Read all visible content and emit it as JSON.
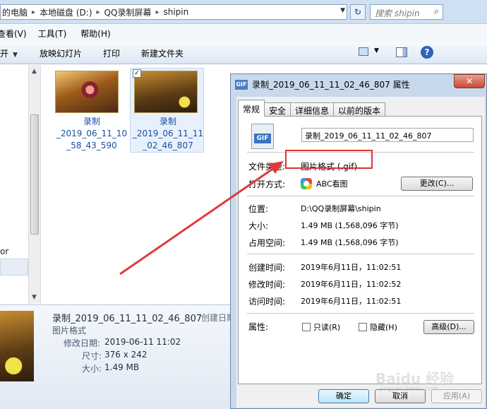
{
  "address": {
    "crumbs": [
      "的电脑",
      "本地磁盘 (D:)",
      "QQ录制屏幕",
      "shipin"
    ],
    "search_placeholder": "搜索 shipin"
  },
  "menu": [
    "查看(V)",
    "工具(T)",
    "帮助(H)"
  ],
  "toolbar": {
    "open_label": "开",
    "slideshow_label": "放映幻灯片",
    "print_label": "打印",
    "new_folder_label": "新建文件夹"
  },
  "nav": {
    "partial_item": "or"
  },
  "files": [
    {
      "name_lines": [
        "录制",
        "_2019_06_11_10",
        "_58_43_590"
      ]
    },
    {
      "name_lines": [
        "录制",
        "_2019_06_11_11",
        "_02_46_807"
      ]
    }
  ],
  "details": {
    "title": "录制_2019_06_11_11_02_46_807",
    "created_label": "创建日期",
    "type": "图片格式",
    "modified_label": "修改日期:",
    "modified_value": "2019-06-11 11:02",
    "dimensions_label": "尺寸:",
    "dimensions_value": "376 x 242",
    "size_label": "大小:",
    "size_value": "1.49 MB"
  },
  "dialog": {
    "title": "录制_2019_06_11_11_02_46_807 属性",
    "icon_text": "GIF",
    "close_label": "✕",
    "tabs": [
      "常规",
      "安全",
      "详细信息",
      "以前的版本"
    ],
    "filename": "录制_2019_06_11_11_02_46_807",
    "file_type_label": "文件类型:",
    "file_type_value": "图片格式 (.gif)",
    "open_with_label": "打开方式:",
    "open_with_value": "ABC看图",
    "change_button": "更改(C)...",
    "location_label": "位置:",
    "location_value": "D:\\QQ录制屏幕\\shipin",
    "size_label": "大小:",
    "size_value": "1.49 MB (1,568,096 字节)",
    "disk_size_label": "占用空间:",
    "disk_size_value": "1.49 MB (1,568,096 字节)",
    "created_label": "创建时间:",
    "created_value": "2019年6月11日，11:02:51",
    "modified_label": "修改时间:",
    "modified_value": "2019年6月11日，11:02:52",
    "accessed_label": "访问时间:",
    "accessed_value": "2019年6月11日，11:02:51",
    "attributes_label": "属性:",
    "readonly_label": "只读(R)",
    "hidden_label": "隐藏(H)",
    "advanced_button": "高级(D)...",
    "ok_button": "确定",
    "cancel_button": "取消",
    "apply_button": "应用(A)"
  },
  "watermark": {
    "text": "Baidu 经验",
    "sub": "jingyan.baidu.com"
  },
  "colors": {
    "highlight": "#e03030",
    "link": "#1a4ea3"
  }
}
